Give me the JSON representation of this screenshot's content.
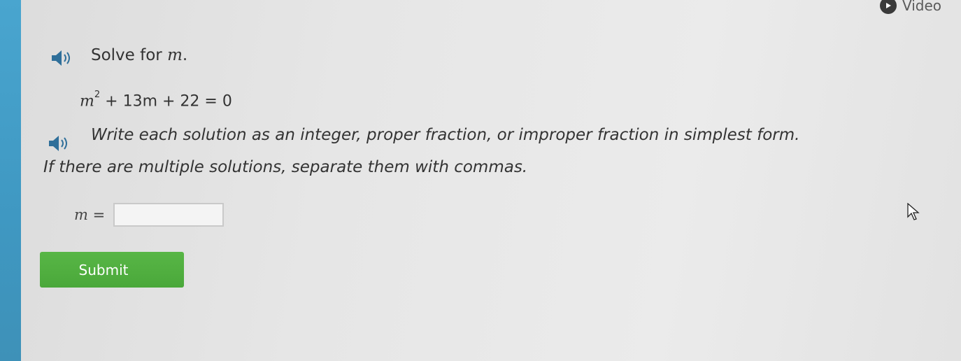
{
  "header": {
    "video_label": "Video",
    "video_icon": "play-icon"
  },
  "question": {
    "audio_icon": "speaker-icon",
    "prompt_text": "Solve for ",
    "prompt_variable": "m",
    "prompt_end": ".",
    "equation": {
      "base": "m",
      "exponent": "2",
      "rest": " + 13m + 22 = 0"
    },
    "instruction_line1": "Write each solution as an integer, proper fraction, or improper fraction in simplest form.",
    "instruction_line2": "If there are multiple solutions, separate them with commas."
  },
  "answer": {
    "label_variable": "m",
    "label_equals": "=",
    "value": "",
    "placeholder": ""
  },
  "submit": {
    "label": "Submit",
    "color": "#52b040"
  },
  "theme": {
    "sidebar_color": "#45a0ca"
  }
}
